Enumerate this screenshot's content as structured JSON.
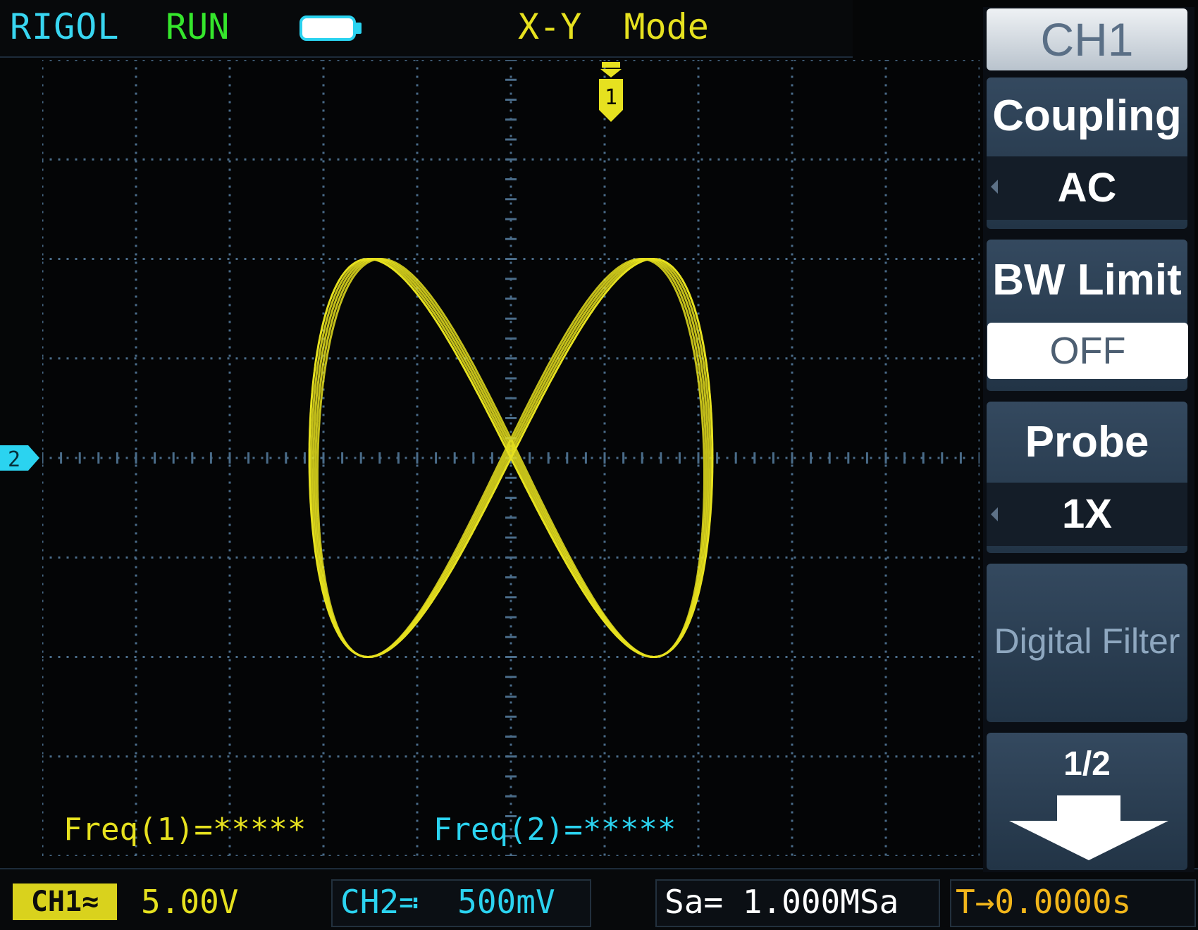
{
  "header": {
    "brand": "RIGOL",
    "status": "RUN",
    "mode_title": "X-Y Mode",
    "battery_icon": "battery-icon"
  },
  "screen": {
    "trigger_marker": "1",
    "ch2_marker": "2",
    "freq1": "Freq(1)=*****",
    "freq2": "Freq(2)=*****"
  },
  "bottom": {
    "ch1_chip": "CH1≈",
    "ch1_scale": "5.00V",
    "ch2": "CH2≕  500mV",
    "sample_rate": "Sa= 1.000MSa",
    "time_offset": "T→0.0000s"
  },
  "menu": {
    "header": "CH1",
    "coupling_label": "Coupling",
    "coupling_value": "AC",
    "bw_label": "BW Limit",
    "bw_value": "OFF",
    "probe_label": "Probe",
    "probe_value": "1X",
    "digital_filter_label": "Digital Filter",
    "page": "1/2",
    "page_down_icon": "page-down-arrow-icon"
  },
  "colors": {
    "ch1": "#e6e11f",
    "ch2": "#2bd3f0",
    "run": "#35e62c",
    "grid": "#4a6c89",
    "brand": "#38d6f1"
  }
}
